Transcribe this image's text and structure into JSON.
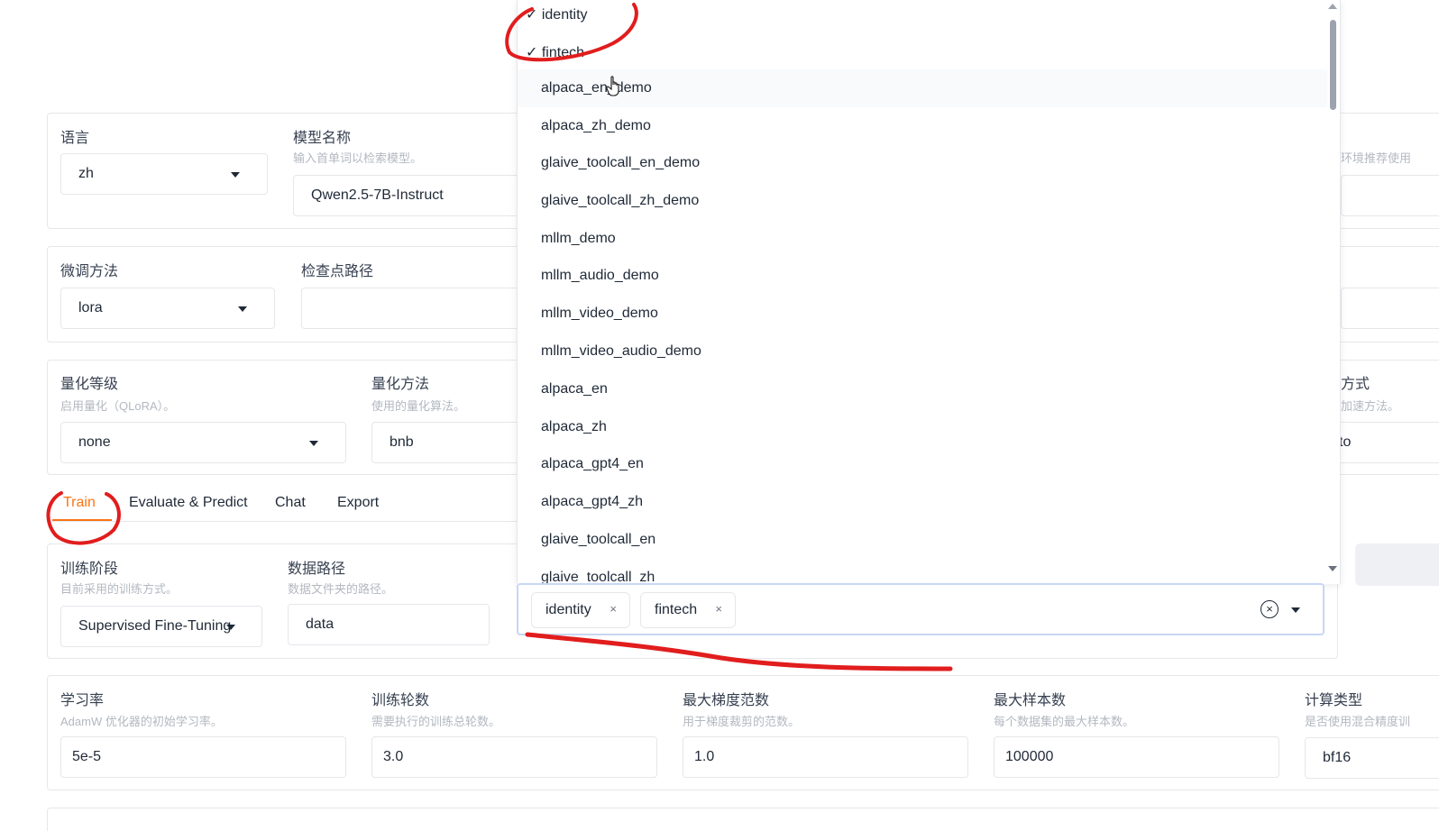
{
  "top": {
    "lang_label": "语言",
    "lang_value": "zh",
    "model_label": "模型名称",
    "model_hint": "输入首单词以检索模型。",
    "model_value": "Qwen2.5-7B-Instruct",
    "finetune_label": "微调方法",
    "finetune_value": "lora",
    "checkpoint_label": "检查点路径",
    "quant_label": "量化等级",
    "quant_hint": "启用量化（QLoRA）。",
    "quant_value": "none",
    "quant_method_label": "量化方法",
    "quant_method_hint": "使用的量化算法。",
    "quant_method_value": "bnb",
    "right_hint_partial": "环境推荐使用",
    "right_label_partial": "方式",
    "right_hint2_partial": "加速方法。",
    "right_value_partial": "to"
  },
  "tabs": [
    {
      "label": "Train",
      "active": true
    },
    {
      "label": "Evaluate & Predict",
      "active": false
    },
    {
      "label": "Chat",
      "active": false
    },
    {
      "label": "Export",
      "active": false
    }
  ],
  "train": {
    "stage_label": "训练阶段",
    "stage_hint": "目前采用的训练方式。",
    "stage_value": "Supervised Fine-Tuning",
    "datadir_label": "数据路径",
    "datadir_hint": "数据文件夹的路径。",
    "datadir_value": "data"
  },
  "hyper": {
    "lr_label": "学习率",
    "lr_hint": "AdamW 优化器的初始学习率。",
    "lr_value": "5e-5",
    "epochs_label": "训练轮数",
    "epochs_hint": "需要执行的训练总轮数。",
    "epochs_value": "3.0",
    "grad_label": "最大梯度范数",
    "grad_hint": "用于梯度裁剪的范数。",
    "grad_value": "1.0",
    "samples_label": "最大样本数",
    "samples_hint": "每个数据集的最大样本数。",
    "samples_value": "100000",
    "compute_label": "计算类型",
    "compute_hint": "是否使用混合精度训",
    "compute_value": "bf16"
  },
  "dropdown": {
    "options": [
      {
        "label": "✓ identity"
      },
      {
        "label": "✓ fintech"
      },
      {
        "label": "alpaca_en_demo"
      },
      {
        "label": "alpaca_zh_demo"
      },
      {
        "label": "glaive_toolcall_en_demo"
      },
      {
        "label": "glaive_toolcall_zh_demo"
      },
      {
        "label": "mllm_demo"
      },
      {
        "label": "mllm_audio_demo"
      },
      {
        "label": "mllm_video_demo"
      },
      {
        "label": "mllm_video_audio_demo"
      },
      {
        "label": "alpaca_en"
      },
      {
        "label": "alpaca_zh"
      },
      {
        "label": "alpaca_gpt4_en"
      },
      {
        "label": "alpaca_gpt4_zh"
      },
      {
        "label": "glaive_toolcall_en"
      },
      {
        "label": "glaive_toolcall_zh"
      }
    ],
    "selected_chips": [
      "identity",
      "fintech"
    ],
    "chip_remove": "×",
    "clear_symbol": "×"
  },
  "colors": {
    "accent": "#f97316",
    "annotation_ink": "#e11d1d"
  }
}
